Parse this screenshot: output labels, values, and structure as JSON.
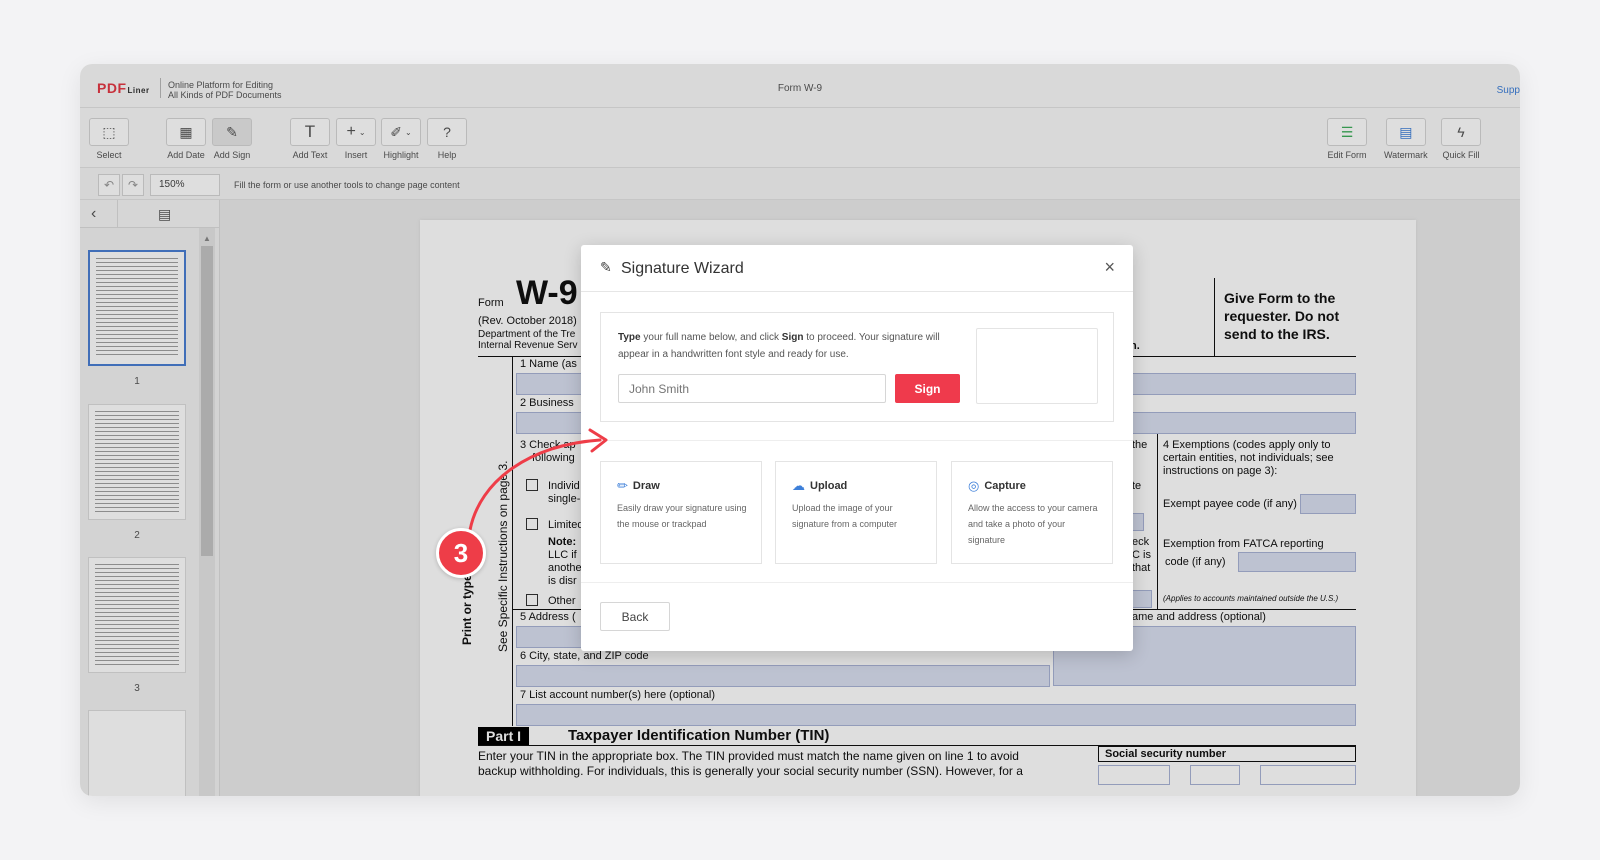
{
  "header": {
    "logo_main": "PDF",
    "logo_sub": "Liner",
    "tagline_line1": "Online Platform for Editing",
    "tagline_line2": "All Kinds of PDF Documents",
    "doc_title": "Form W-9",
    "support": "Supp"
  },
  "toolbar": {
    "select": "Select",
    "add_date": "Add Date",
    "add_sign": "Add Sign",
    "add_text": "Add Text",
    "insert": "Insert",
    "highlight": "Highlight",
    "help": "Help",
    "edit_form": "Edit Form",
    "watermark": "Watermark",
    "quick_fill": "Quick Fill"
  },
  "subbar": {
    "zoom": "150%",
    "hint": "Fill the form or use another tools to change page content"
  },
  "sidebar": {
    "pages": [
      "1",
      "2",
      "3"
    ]
  },
  "form": {
    "form_label": "Form",
    "form_number": "W-9",
    "rev": "(Rev. October 2018)",
    "dept": "Department of the Tre",
    "irs": "Internal Revenue Serv",
    "give_form": "Give Form to the",
    "requester": "requester. Do not",
    "send_irs": "send to the IRS.",
    "n_dot": "n.",
    "line1": "1  Name (as",
    "line2": "2  Business",
    "line3a": "3  Check ap",
    "line3b": "following",
    "individ": "Individ",
    "single": "single-",
    "limited": "Limited",
    "note": "Note:",
    "llc_if": "LLC if",
    "anothe": "anothe",
    "is_disr": "is disr",
    "other": "Other",
    "line5": "5  Address (",
    "line6": "6  City, state, and ZIP code",
    "line7": "7  List account number(s) here (optional)",
    "side_print": "Print or type.",
    "side_see": "See Specific Instructions on page 3.",
    "the": "the",
    "te": "te",
    "eck": "eck",
    "cis": "C is",
    "that": "that",
    "ex4a": "4  Exemptions (codes apply only to",
    "ex4b": "certain entities, not individuals; see",
    "ex4c": "instructions on page 3):",
    "exempt_payee": "Exempt payee code (if any)",
    "fatca1": "Exemption from FATCA reporting",
    "fatca2": "code (if any)",
    "applies": "(Applies to accounts maintained outside the U.S.)",
    "name_addr": "ame and address (optional)",
    "part1": "Part I",
    "tin_title": "Taxpayer Identification Number (TIN)",
    "tin_text1": "Enter your TIN in the appropriate box. The TIN provided must match the name given on line 1 to avoid",
    "tin_text2": "backup withholding. For individuals, this is generally your social security number (SSN). However, for a",
    "ssn": "Social security number"
  },
  "modal": {
    "title": "Signature Wizard",
    "close": "×",
    "type_word": "Type",
    "desc_mid": " your full name below, and click ",
    "sign_word": "Sign",
    "desc_end": " to proceed. Your signature will appear in a handwritten font style and ready for use.",
    "input_placeholder": "John Smith",
    "sign_button": "Sign",
    "options": [
      {
        "title": "Draw",
        "desc": "Easily draw your signature using the mouse or trackpad"
      },
      {
        "title": "Upload",
        "desc": "Upload the image of your signature from a computer"
      },
      {
        "title": "Capture",
        "desc": "Allow the access to your camera and take a photo of your signature"
      }
    ],
    "back_button": "Back"
  },
  "step_badge": "3",
  "colors": {
    "accent": "#ef3a4c",
    "link": "#3d7fd9",
    "field_fill": "#d9dff0"
  }
}
